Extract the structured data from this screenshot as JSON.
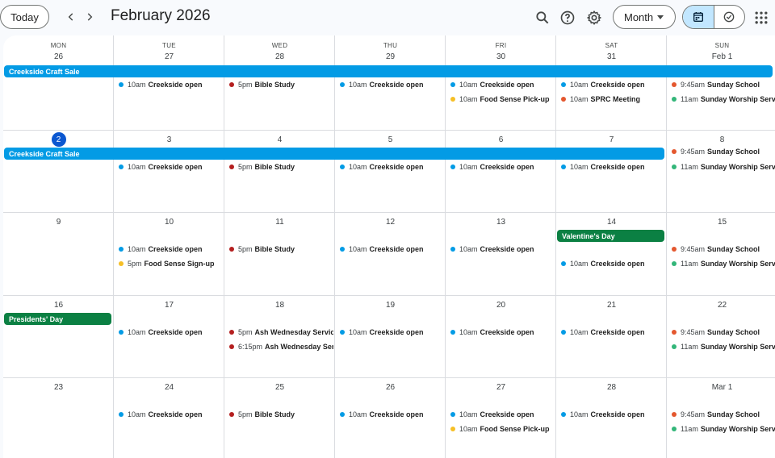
{
  "header": {
    "today_label": "Today",
    "title": "February 2026",
    "view_label": "Month"
  },
  "colors": {
    "blue_bar": "#039be5",
    "green_bar": "#0b8043",
    "teal_dot": "#039be5",
    "red_dot": "#b41f1f",
    "yellow_dot": "#f6bf26",
    "orange_dot": "#e4572e",
    "green_dot": "#33b679",
    "today_circle": "#0b57d0"
  },
  "weekdays": [
    "MON",
    "TUE",
    "WED",
    "THU",
    "FRI",
    "SAT",
    "SUN"
  ],
  "weeks": [
    {
      "days": [
        "26",
        "27",
        "28",
        "29",
        "30",
        "31",
        "Feb 1"
      ],
      "bars": [
        {
          "label": "Creekside Craft Sale",
          "start": 0,
          "span": 7,
          "color": "blue"
        }
      ],
      "events": [
        {
          "day": 1,
          "row": 0,
          "time": "10am",
          "name": "Creekside open",
          "dot": "teal"
        },
        {
          "day": 2,
          "row": 0,
          "time": "5pm",
          "name": "Bible Study",
          "dot": "red"
        },
        {
          "day": 3,
          "row": 0,
          "time": "10am",
          "name": "Creekside open",
          "dot": "teal"
        },
        {
          "day": 4,
          "row": 0,
          "time": "10am",
          "name": "Creekside open",
          "dot": "teal"
        },
        {
          "day": 4,
          "row": 1,
          "time": "10am",
          "name": "Food Sense Pick-up",
          "dot": "yellow"
        },
        {
          "day": 5,
          "row": 0,
          "time": "10am",
          "name": "Creekside open",
          "dot": "teal"
        },
        {
          "day": 5,
          "row": 1,
          "time": "10am",
          "name": "SPRC Meeting",
          "dot": "orange"
        },
        {
          "day": 6,
          "row": 0,
          "time": "9:45am",
          "name": "Sunday School",
          "dot": "orange"
        },
        {
          "day": 6,
          "row": 1,
          "time": "11am",
          "name": "Sunday Worship Service",
          "dot": "green"
        }
      ]
    },
    {
      "days": [
        "2",
        "3",
        "4",
        "5",
        "6",
        "7",
        "8"
      ],
      "today_index": 0,
      "bars": [
        {
          "label": "Creekside Craft Sale",
          "start": 0,
          "span": 6,
          "color": "blue"
        }
      ],
      "events": [
        {
          "day": 1,
          "row": 0,
          "time": "10am",
          "name": "Creekside open",
          "dot": "teal"
        },
        {
          "day": 2,
          "row": 0,
          "time": "5pm",
          "name": "Bible Study",
          "dot": "red"
        },
        {
          "day": 3,
          "row": 0,
          "time": "10am",
          "name": "Creekside open",
          "dot": "teal"
        },
        {
          "day": 4,
          "row": 0,
          "time": "10am",
          "name": "Creekside open",
          "dot": "teal"
        },
        {
          "day": 5,
          "row": 0,
          "time": "10am",
          "name": "Creekside open",
          "dot": "teal"
        },
        {
          "day": 6,
          "row": -1,
          "time": "9:45am",
          "name": "Sunday School",
          "dot": "orange"
        },
        {
          "day": 6,
          "row": 0,
          "time": "11am",
          "name": "Sunday Worship Service",
          "dot": "green"
        }
      ]
    },
    {
      "days": [
        "9",
        "10",
        "11",
        "12",
        "13",
        "14",
        "15"
      ],
      "bars": [
        {
          "label": "Valentine's Day",
          "start": 5,
          "span": 1,
          "color": "green"
        }
      ],
      "events": [
        {
          "day": 1,
          "row": 0,
          "time": "10am",
          "name": "Creekside open",
          "dot": "teal"
        },
        {
          "day": 1,
          "row": 1,
          "time": "5pm",
          "name": "Food Sense Sign-up",
          "dot": "yellow"
        },
        {
          "day": 2,
          "row": 0,
          "time": "5pm",
          "name": "Bible Study",
          "dot": "red"
        },
        {
          "day": 3,
          "row": 0,
          "time": "10am",
          "name": "Creekside open",
          "dot": "teal"
        },
        {
          "day": 4,
          "row": 0,
          "time": "10am",
          "name": "Creekside open",
          "dot": "teal"
        },
        {
          "day": 5,
          "row": 1,
          "time": "10am",
          "name": "Creekside open",
          "dot": "teal"
        },
        {
          "day": 6,
          "row": 0,
          "time": "9:45am",
          "name": "Sunday School",
          "dot": "orange"
        },
        {
          "day": 6,
          "row": 1,
          "time": "11am",
          "name": "Sunday Worship Service",
          "dot": "green"
        }
      ]
    },
    {
      "days": [
        "16",
        "17",
        "18",
        "19",
        "20",
        "21",
        "22"
      ],
      "bars": [
        {
          "label": "Presidents' Day",
          "start": 0,
          "span": 1,
          "color": "green"
        }
      ],
      "events": [
        {
          "day": 1,
          "row": 0,
          "time": "10am",
          "name": "Creekside open",
          "dot": "teal"
        },
        {
          "day": 2,
          "row": 0,
          "time": "5pm",
          "name": "Ash Wednesday Service",
          "dot": "red"
        },
        {
          "day": 2,
          "row": 1,
          "time": "6:15pm",
          "name": "Ash Wednesday Service",
          "dot": "red"
        },
        {
          "day": 3,
          "row": 0,
          "time": "10am",
          "name": "Creekside open",
          "dot": "teal"
        },
        {
          "day": 4,
          "row": 0,
          "time": "10am",
          "name": "Creekside open",
          "dot": "teal"
        },
        {
          "day": 5,
          "row": 0,
          "time": "10am",
          "name": "Creekside open",
          "dot": "teal"
        },
        {
          "day": 6,
          "row": 0,
          "time": "9:45am",
          "name": "Sunday School",
          "dot": "orange"
        },
        {
          "day": 6,
          "row": 1,
          "time": "11am",
          "name": "Sunday Worship Service",
          "dot": "green"
        }
      ]
    },
    {
      "days": [
        "23",
        "24",
        "25",
        "26",
        "27",
        "28",
        "Mar 1"
      ],
      "bars": [],
      "events": [
        {
          "day": 1,
          "row": 0,
          "time": "10am",
          "name": "Creekside open",
          "dot": "teal"
        },
        {
          "day": 2,
          "row": 0,
          "time": "5pm",
          "name": "Bible Study",
          "dot": "red"
        },
        {
          "day": 3,
          "row": 0,
          "time": "10am",
          "name": "Creekside open",
          "dot": "teal"
        },
        {
          "day": 4,
          "row": 0,
          "time": "10am",
          "name": "Creekside open",
          "dot": "teal"
        },
        {
          "day": 4,
          "row": 1,
          "time": "10am",
          "name": "Food Sense Pick-up",
          "dot": "yellow"
        },
        {
          "day": 5,
          "row": 0,
          "time": "10am",
          "name": "Creekside open",
          "dot": "teal"
        },
        {
          "day": 6,
          "row": 0,
          "time": "9:45am",
          "name": "Sunday School",
          "dot": "orange"
        },
        {
          "day": 6,
          "row": 1,
          "time": "11am",
          "name": "Sunday Worship Service",
          "dot": "green"
        }
      ]
    }
  ],
  "icons": {
    "prev": "chevron-left-icon",
    "next": "chevron-right-icon",
    "search": "search-icon",
    "help": "help-icon",
    "settings": "gear-icon",
    "calendar": "calendar-icon",
    "tasks": "tasks-icon",
    "apps": "apps-grid-icon"
  }
}
